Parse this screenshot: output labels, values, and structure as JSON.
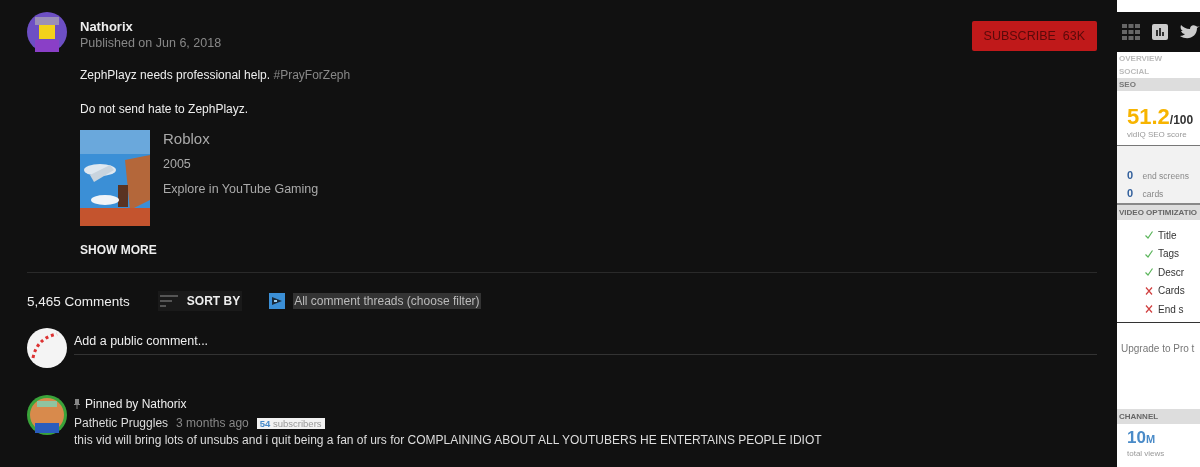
{
  "video_owner": {
    "name": "Nathorix",
    "published": "Published on Jun 6, 2018",
    "subscribe_button": {
      "label": "SUBSCRIBE",
      "count": "63K"
    }
  },
  "description": [
    {
      "text": "ZephPlayz needs professional help.",
      "hashtag": "#PrayForZeph"
    },
    {
      "text": "Do not send hate to ZephPlayz."
    }
  ],
  "game": {
    "title": "Roblox",
    "year": "2005",
    "link": "Explore in YouTube Gaming"
  },
  "show_more": "SHOW MORE",
  "comments": {
    "count": "5,465 Comments",
    "sort_by": "SORT BY",
    "filter": "All comment threads (choose filter)",
    "add_comment": {
      "placeholder": "Add a public comment..."
    },
    "items": [
      {
        "pinned": "Pinned by Nathorix",
        "author": "Pathetic Pruggles",
        "time": "3 months ago",
        "subscribers": {
          "count": "54",
          "label": "subscribers"
        },
        "text": "this vid will bring lots of unsubs and i quit being a fan of urs for COMPLAINING ABOUT ALL YOUTUBERS HE ENTERTAINS PEOPLE IDIOT"
      }
    ]
  },
  "sidebar": {
    "tabs": [
      {
        "label": "OVERVIEW",
        "selected": false
      },
      {
        "label": "SOCIAL",
        "selected": false
      },
      {
        "label": "SEO",
        "selected": true
      }
    ],
    "seo_score": {
      "value": "51.2",
      "max": "/100",
      "label": "vidIQ SEO score"
    },
    "counts": [
      {
        "value": "0",
        "label": "end screens"
      },
      {
        "value": "0",
        "label": "cards"
      }
    ],
    "optimization": {
      "title": "VIDEO OPTIMIZATIO",
      "items": [
        {
          "label": "Title",
          "checked": true
        },
        {
          "label": "Tags",
          "checked": true
        },
        {
          "label": "Descr",
          "checked": true
        },
        {
          "label": "Cards",
          "checked": false
        },
        {
          "label": "End s",
          "checked": false
        }
      ]
    },
    "upgrade": "Upgrade to Pro t",
    "channel": {
      "title": "CHANNEL",
      "value": "10",
      "unit": "M",
      "label": "total views"
    }
  }
}
